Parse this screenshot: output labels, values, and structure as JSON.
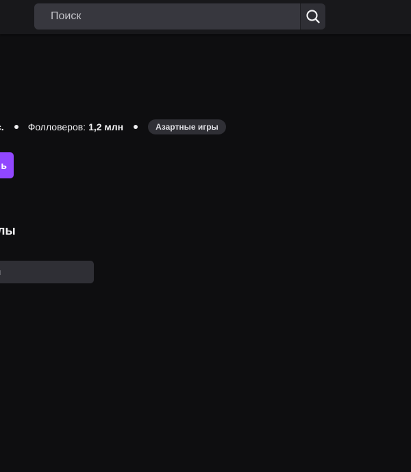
{
  "header": {
    "search": {
      "placeholder": "Поиск",
      "button_icon": "search-icon"
    }
  },
  "channel": {
    "stats_prefix": "с.",
    "followers_label": "Фолловеров:",
    "followers_value": "1,2 млн",
    "category_tag": "Азартные игры",
    "follow_button_label": "ь"
  },
  "section": {
    "title": "лы",
    "filter_text": "н"
  },
  "colors": {
    "background": "#0e0e10",
    "topbar": "#18181b",
    "accent": "#9147ff",
    "tag_bg": "#2f2f35"
  }
}
